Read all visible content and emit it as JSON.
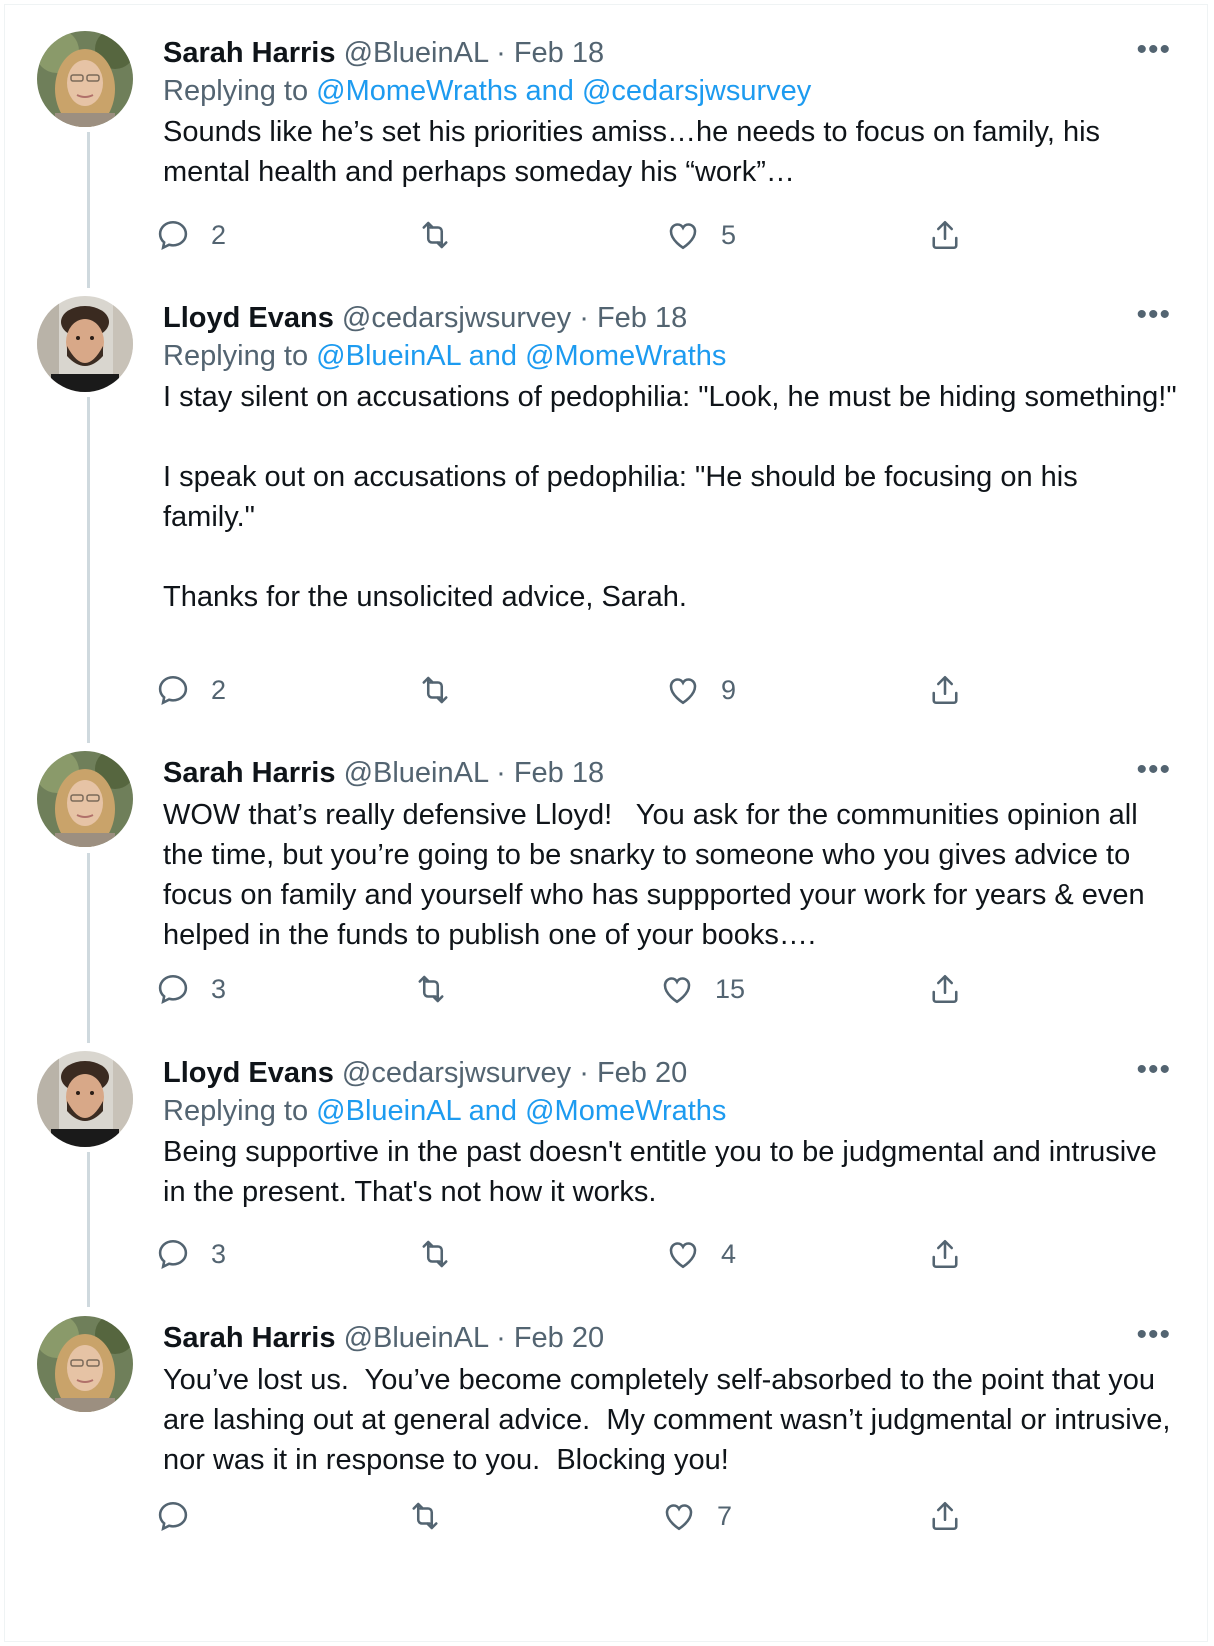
{
  "tweets": [
    {
      "name": "Sarah Harris",
      "handle": "@BlueinAL",
      "separator": "·",
      "date": "Feb 18",
      "replying_prefix": "Replying to ",
      "replying_to": "@MomeWraths and @cedarsjwsurvey",
      "text": "Sounds like he’s set his priorities amiss…he needs to focus on family, his mental health and perhaps someday his “work”…",
      "replies": "2",
      "retweets": "",
      "likes": "5",
      "more": "•••"
    },
    {
      "name": "Lloyd Evans",
      "handle": "@cedarsjwsurvey",
      "separator": "·",
      "date": "Feb 18",
      "replying_prefix": "Replying to ",
      "replying_to": "@BlueinAL and @MomeWraths",
      "text": "I stay silent on accusations of pedophilia: \"Look, he must be hiding something!\"\n\nI speak out on accusations of pedophilia: \"He should be focusing on his family.\"\n\nThanks for the unsolicited advice, Sarah.",
      "replies": "2",
      "retweets": "",
      "likes": "9",
      "more": "•••"
    },
    {
      "name": "Sarah Harris",
      "handle": "@BlueinAL",
      "separator": "·",
      "date": "Feb 18",
      "text": "WOW that’s really defensive Lloyd!   You ask for the communities opinion all the time, but you’re going to be snarky to someone who you gives advice to focus on family and yourself who has suppported your work for years & even helped in the funds to publish one of your books….",
      "replies": "3",
      "retweets": "",
      "likes": "15",
      "more": "•••"
    },
    {
      "name": "Lloyd Evans",
      "handle": "@cedarsjwsurvey",
      "separator": "·",
      "date": "Feb 20",
      "replying_prefix": "Replying to ",
      "replying_to": "@BlueinAL and @MomeWraths",
      "text": "Being supportive in the past doesn't entitle you to be judgmental and intrusive in the present. That's not how it works.",
      "replies": "3",
      "retweets": "",
      "likes": "4",
      "more": "•••"
    },
    {
      "name": "Sarah Harris",
      "handle": "@BlueinAL",
      "separator": "·",
      "date": "Feb 20",
      "text": "You’ve lost us.  You’ve become completely self-absorbed to the point that you are lashing out at general advice.  My comment wasn’t judgmental or intrusive, nor was it in response to you.  Blocking you!",
      "replies": "",
      "retweets": "",
      "likes": "7",
      "more": "•••"
    }
  ],
  "icons": {
    "reply": "reply-icon",
    "retweet": "retweet-icon",
    "like": "heart-icon",
    "share": "share-icon",
    "more": "more-icon"
  },
  "colors": {
    "text": "#0f1419",
    "secondary": "#536471",
    "link": "#1d9bf0",
    "thread_line": "#cfd9de"
  }
}
